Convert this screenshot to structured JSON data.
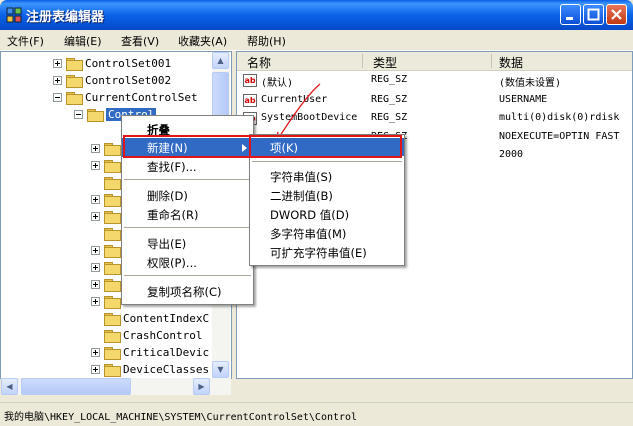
{
  "window": {
    "title": "注册表编辑器"
  },
  "menubar": [
    {
      "label": "文件(F)"
    },
    {
      "label": "编辑(E)"
    },
    {
      "label": "查看(V)"
    },
    {
      "label": "收藏夹(A)"
    },
    {
      "label": "帮助(H)"
    }
  ],
  "tree": {
    "items": [
      {
        "label": "ControlSet001"
      },
      {
        "label": "ControlSet002"
      },
      {
        "label": "CurrentControlSet"
      },
      {
        "label": "Control"
      },
      {
        "label": "ContentIndexC"
      },
      {
        "label": "CrashControl"
      },
      {
        "label": "CriticalDevic"
      },
      {
        "label": "DeviceClasses"
      }
    ]
  },
  "list": {
    "headers": {
      "name": "名称",
      "type": "类型",
      "data": "数据"
    },
    "rows": [
      {
        "name": "(默认)",
        "type": "REG_SZ",
        "data": "(数值未设置)"
      },
      {
        "name": "CurrentUser",
        "type": "REG_SZ",
        "data": "USERNAME"
      },
      {
        "name": "SystemBootDevice",
        "type": "REG_SZ",
        "data": "multi(0)disk(0)rdisk"
      },
      {
        "name": "",
        "type": "REG_SZ",
        "data": "NOEXECUTE=OPTIN  FAST"
      },
      {
        "name": "",
        "type": "",
        "data": "2000"
      }
    ]
  },
  "context_menu": {
    "items": [
      {
        "label": "折叠"
      },
      {
        "label": "新建(N)"
      },
      {
        "label": "查找(F)..."
      },
      {
        "label": "删除(D)"
      },
      {
        "label": "重命名(R)"
      },
      {
        "label": "导出(E)"
      },
      {
        "label": "权限(P)..."
      },
      {
        "label": "复制项名称(C)"
      }
    ]
  },
  "submenu": {
    "items": [
      {
        "label": "项(K)"
      },
      {
        "label": "字符串值(S)"
      },
      {
        "label": "二进制值(B)"
      },
      {
        "label": "DWORD 值(D)"
      },
      {
        "label": "多字符串值(M)"
      },
      {
        "label": "可扩充字符串值(E)"
      }
    ]
  },
  "status": {
    "path": "我的电脑\\HKEY_LOCAL_MACHINE\\SYSTEM\\CurrentControlSet\\Control"
  },
  "colors": {
    "highlight": "#316ac5",
    "annotation": "#e0151a"
  }
}
